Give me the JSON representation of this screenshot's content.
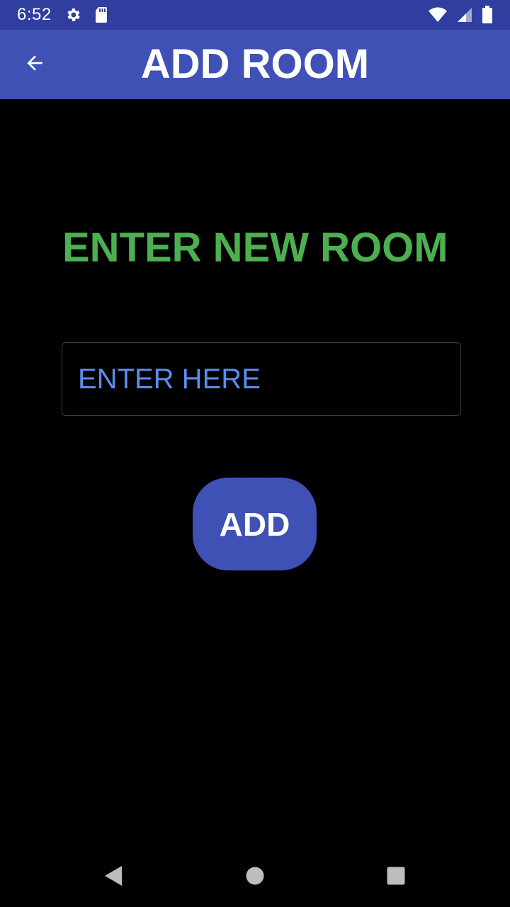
{
  "status_bar": {
    "time": "6:52",
    "icons": [
      "settings-icon",
      "sd-card-icon",
      "wifi-icon",
      "signal-icon",
      "battery-icon"
    ]
  },
  "app_bar": {
    "title": "ADD ROOM",
    "back_icon": "arrow-back-icon"
  },
  "main": {
    "heading": "ENTER NEW ROOM",
    "input": {
      "placeholder": "ENTER HERE",
      "value": ""
    },
    "add_button_label": "ADD"
  },
  "nav_bar": {
    "icons": [
      "back-triangle-icon",
      "home-circle-icon",
      "recents-square-icon"
    ]
  },
  "colors": {
    "primary": "#3F51B5",
    "primary_dark": "#303F9F",
    "heading_green": "#4CAF50",
    "placeholder_blue": "#5B8DEF",
    "background": "#000000"
  }
}
